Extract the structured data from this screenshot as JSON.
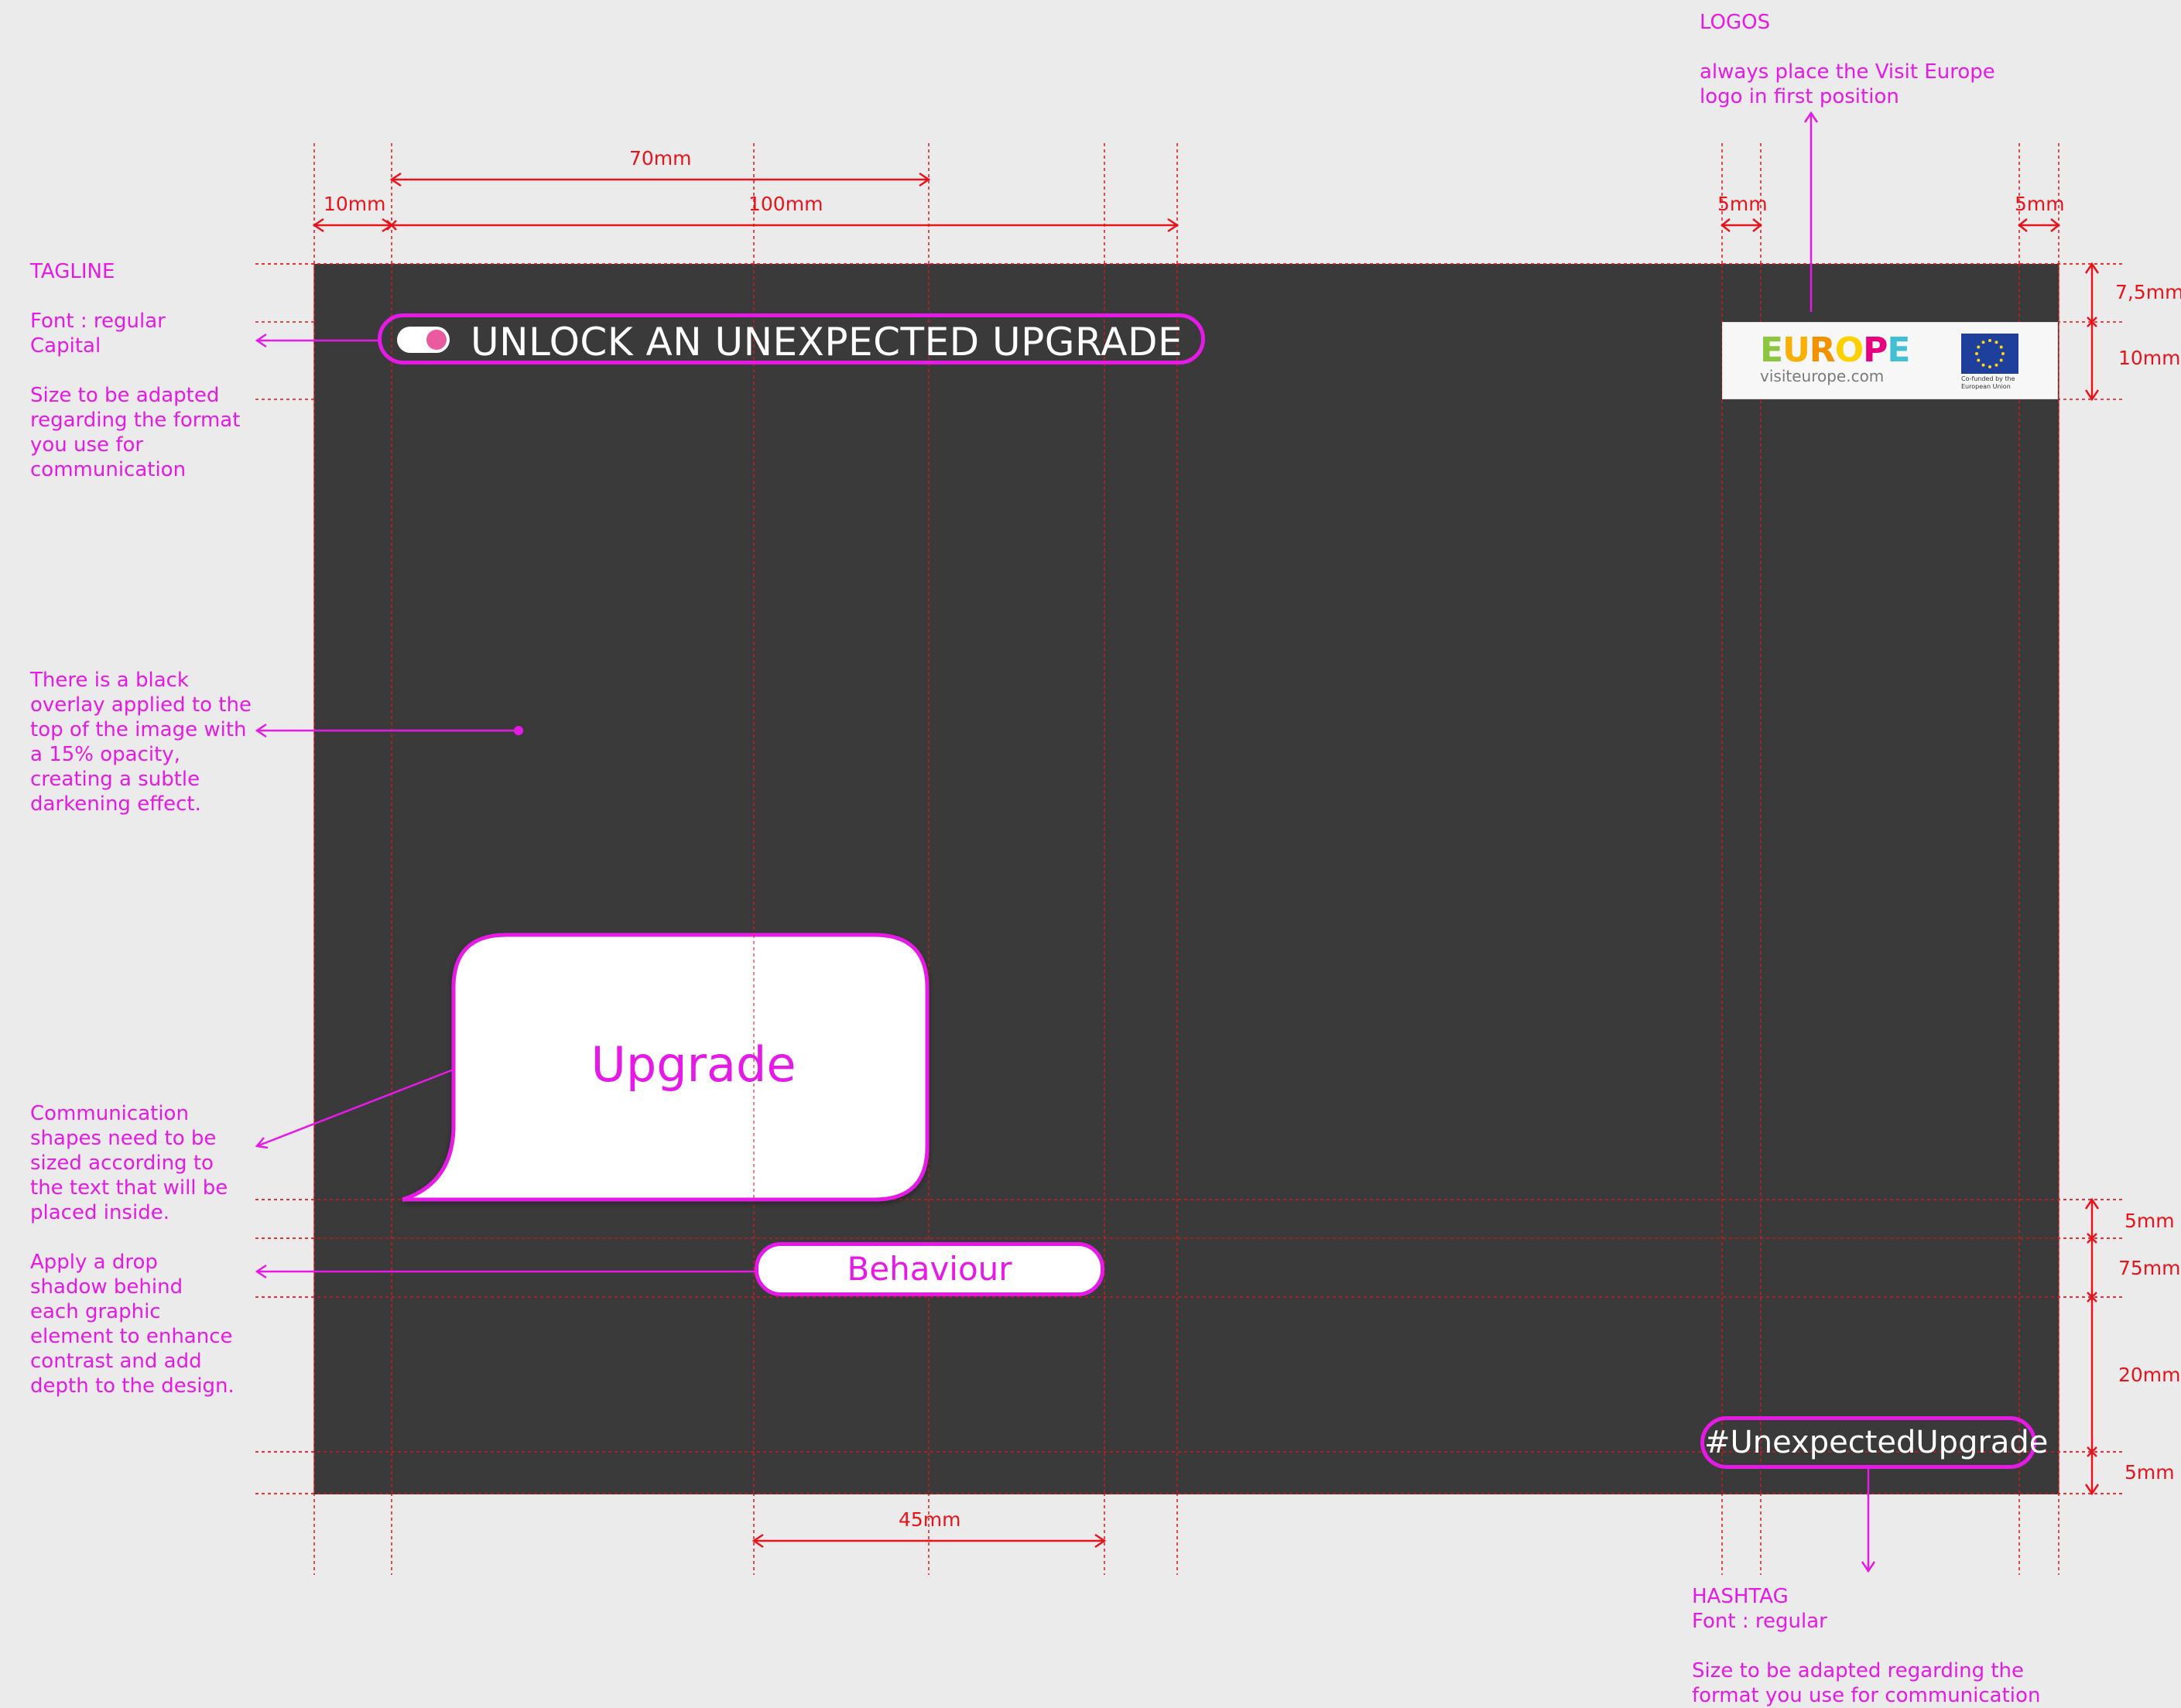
{
  "annotations": {
    "logos_title": "LOGOS",
    "logos_note": "always place the Visit Europe\nlogo in first position",
    "tagline_title": "TAGLINE",
    "tagline_font": "Font : regular\nCapital",
    "tagline_size": "Size to be adapted\nregarding the format\nyou use for\ncommunication",
    "overlay_note": "There is a black\noverlay applied to the\ntop of the image with\na 15% opacity,\ncreating a subtle\ndarkening effect.",
    "shapes_note": "Communication\nshapes need to be\nsized according to\nthe text that will be\nplaced inside.",
    "shadow_note": "Apply a drop\nshadow behind\neach graphic\nelement to enhance\ncontrast and add\ndepth to the design.",
    "hashtag_title": "HASHTAG\nFont : regular",
    "hashtag_size": "Size to be adapted regarding the\nformat you use for communication"
  },
  "dimensions": {
    "d70": "70mm",
    "d10": "10mm",
    "d100": "100mm",
    "d5_left": "5mm",
    "d5_right": "5mm",
    "d7_5": "7,5mm",
    "d10_right": "10mm",
    "d5_a": "5mm",
    "d75": "75mm",
    "d20": "20mm",
    "d5_b": "5mm",
    "d45": "45mm"
  },
  "layout_content": {
    "tagline": "UNLOCK AN UNEXPECTED UPGRADE",
    "upgrade_bubble": "Upgrade",
    "behaviour_pill": "Behaviour",
    "hashtag": "#UnexpectedUpgrade"
  },
  "logo": {
    "wordmark_letters": [
      "E",
      "U",
      "R",
      "O",
      "P",
      "E"
    ],
    "wordmark_colors": [
      "#8cc63f",
      "#f9b000",
      "#f39200",
      "#fdd000",
      "#e6007e",
      "#41c0d3"
    ],
    "url": "visiteurope.com",
    "eu_caption": "Co-funded by the\nEuropean Union"
  },
  "colors": {
    "accent": "#e61ae6",
    "guide": "#e8141c",
    "canvas": "#3a3a3a",
    "background": "#ebebeb"
  }
}
